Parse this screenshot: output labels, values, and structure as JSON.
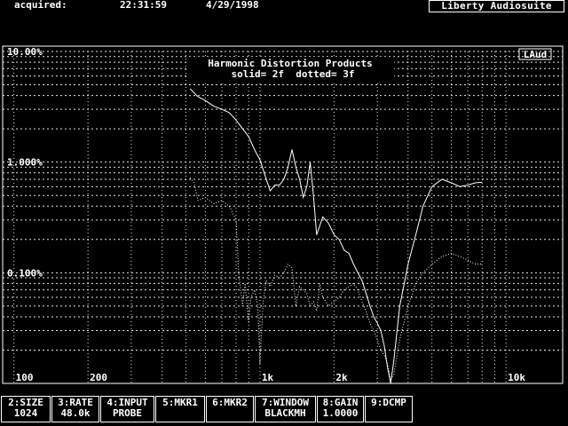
{
  "header": {
    "acquired_label": "acquired:",
    "time": "22:31:59",
    "date": "4/29/1998",
    "brand": "Liberty Audiosuite"
  },
  "plot": {
    "badge": "LAud",
    "title_line1": "Harmonic Distortion Products",
    "title_line2": "solid= 2f  dotted= 3f"
  },
  "softkeys": [
    {
      "top": "2:SIZE",
      "bottom": "1024"
    },
    {
      "top": "3:RATE",
      "bottom": "48.0k"
    },
    {
      "top": "4:INPUT",
      "bottom": "PROBE"
    },
    {
      "top": "5:MKR1",
      "bottom": ""
    },
    {
      "top": "6:MKR2",
      "bottom": ""
    },
    {
      "top": "7:WINDOW",
      "bottom": "BLACKMH"
    },
    {
      "top": "8:GAIN",
      "bottom": "1.0000"
    },
    {
      "top": "9:DCMP",
      "bottom": ""
    }
  ],
  "chart_data": {
    "type": "line",
    "title": "Harmonic Distortion Products",
    "subtitle": "solid= 2f  dotted= 3f",
    "x_scale": "log",
    "y_scale": "log",
    "xlim": [
      90,
      17000
    ],
    "ylim": [
      0.01,
      10
    ],
    "x_ticks": [
      {
        "value": 100,
        "label": "100"
      },
      {
        "value": 200,
        "label": "200"
      },
      {
        "value": 1000,
        "label": "1k"
      },
      {
        "value": 2000,
        "label": "2k"
      },
      {
        "value": 10000,
        "label": "10k"
      }
    ],
    "y_ticks": [
      {
        "value": 10,
        "label": "10.00%"
      },
      {
        "value": 1,
        "label": "1.000%"
      },
      {
        "value": 0.1,
        "label": "0.100%"
      }
    ],
    "grid": true,
    "series": [
      {
        "name": "2f",
        "style": "solid",
        "points": [
          [
            520,
            4.6
          ],
          [
            560,
            3.9
          ],
          [
            600,
            3.6
          ],
          [
            650,
            3.2
          ],
          [
            700,
            3.0
          ],
          [
            750,
            2.8
          ],
          [
            800,
            2.4
          ],
          [
            850,
            2.0
          ],
          [
            900,
            1.7
          ],
          [
            950,
            1.3
          ],
          [
            1000,
            1.05
          ],
          [
            1050,
            0.75
          ],
          [
            1100,
            0.55
          ],
          [
            1150,
            0.62
          ],
          [
            1200,
            0.62
          ],
          [
            1250,
            0.7
          ],
          [
            1300,
            0.9
          ],
          [
            1350,
            1.3
          ],
          [
            1400,
            0.9
          ],
          [
            1450,
            0.7
          ],
          [
            1500,
            0.48
          ],
          [
            1550,
            0.6
          ],
          [
            1600,
            1.0
          ],
          [
            1650,
            0.5
          ],
          [
            1700,
            0.22
          ],
          [
            1800,
            0.32
          ],
          [
            1900,
            0.28
          ],
          [
            2000,
            0.22
          ],
          [
            2100,
            0.2
          ],
          [
            2200,
            0.16
          ],
          [
            2300,
            0.15
          ],
          [
            2400,
            0.12
          ],
          [
            2500,
            0.1
          ],
          [
            2600,
            0.085
          ],
          [
            2700,
            0.065
          ],
          [
            2800,
            0.05
          ],
          [
            2900,
            0.04
          ],
          [
            3000,
            0.035
          ],
          [
            3100,
            0.03
          ],
          [
            3200,
            0.022
          ],
          [
            3300,
            0.014
          ],
          [
            3400,
            0.01
          ],
          [
            3500,
            0.016
          ],
          [
            3700,
            0.05
          ],
          [
            4000,
            0.12
          ],
          [
            4300,
            0.22
          ],
          [
            4600,
            0.4
          ],
          [
            5000,
            0.6
          ],
          [
            5500,
            0.7
          ],
          [
            6000,
            0.65
          ],
          [
            6500,
            0.6
          ],
          [
            7000,
            0.62
          ],
          [
            7500,
            0.65
          ],
          [
            8000,
            0.66
          ]
        ]
      },
      {
        "name": "3f",
        "style": "dotted",
        "points": [
          [
            520,
            0.72
          ],
          [
            540,
            0.65
          ],
          [
            560,
            0.45
          ],
          [
            600,
            0.48
          ],
          [
            650,
            0.42
          ],
          [
            700,
            0.45
          ],
          [
            750,
            0.4
          ],
          [
            800,
            0.3
          ],
          [
            820,
            0.1
          ],
          [
            850,
            0.05
          ],
          [
            870,
            0.08
          ],
          [
            900,
            0.035
          ],
          [
            920,
            0.06
          ],
          [
            950,
            0.07
          ],
          [
            980,
            0.05
          ],
          [
            1000,
            0.015
          ],
          [
            1030,
            0.055
          ],
          [
            1060,
            0.085
          ],
          [
            1100,
            0.075
          ],
          [
            1150,
            0.095
          ],
          [
            1200,
            0.09
          ],
          [
            1250,
            0.1
          ],
          [
            1300,
            0.12
          ],
          [
            1350,
            0.11
          ],
          [
            1400,
            0.05
          ],
          [
            1450,
            0.075
          ],
          [
            1500,
            0.07
          ],
          [
            1550,
            0.065
          ],
          [
            1600,
            0.05
          ],
          [
            1650,
            0.055
          ],
          [
            1700,
            0.045
          ],
          [
            1750,
            0.08
          ],
          [
            1800,
            0.06
          ],
          [
            1850,
            0.055
          ],
          [
            1900,
            0.05
          ],
          [
            2000,
            0.055
          ],
          [
            2100,
            0.06
          ],
          [
            2200,
            0.07
          ],
          [
            2300,
            0.075
          ],
          [
            2400,
            0.08
          ],
          [
            2500,
            0.07
          ],
          [
            2600,
            0.055
          ],
          [
            2700,
            0.045
          ],
          [
            2800,
            0.035
          ],
          [
            2900,
            0.03
          ],
          [
            3000,
            0.025
          ],
          [
            3100,
            0.02
          ],
          [
            3200,
            0.018
          ],
          [
            3300,
            0.015
          ],
          [
            3400,
            0.011
          ],
          [
            3500,
            0.012
          ],
          [
            3700,
            0.025
          ],
          [
            4000,
            0.05
          ],
          [
            4300,
            0.08
          ],
          [
            4600,
            0.1
          ],
          [
            5000,
            0.12
          ],
          [
            5500,
            0.14
          ],
          [
            6000,
            0.15
          ],
          [
            6500,
            0.14
          ],
          [
            7000,
            0.13
          ],
          [
            7500,
            0.12
          ],
          [
            8000,
            0.12
          ]
        ]
      }
    ]
  },
  "colors": {
    "background": "#000000",
    "foreground": "#ffffff"
  }
}
